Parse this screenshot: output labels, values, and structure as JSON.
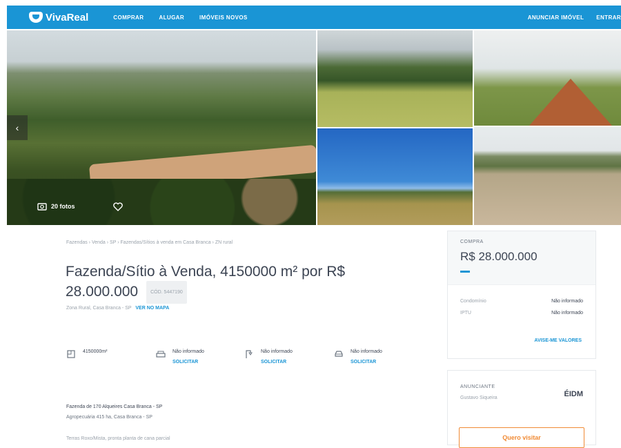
{
  "header": {
    "brand": "VivaReal",
    "nav": [
      "COMPRAR",
      "ALUGAR",
      "IMÓVEIS NOVOS"
    ],
    "right_nav": [
      "ANUNCIAR IMÓVEL",
      "ENTRAR"
    ],
    "color": "#1a95d5"
  },
  "gallery": {
    "photos_label": "20 fotos",
    "prev_arrow": "‹"
  },
  "listing": {
    "breadcrumb": "Fazendas › Venda › SP › Fazendas/Sítios à venda em Casa Branca › ZN rural",
    "title": "Fazenda/Sítio à Venda, 4150000 m² por R$ 28.000.000",
    "code": "CÓD. 5447190",
    "address": "Zona Rural, Casa Branca - SP",
    "map_link": "VER NO MAPA",
    "features": [
      {
        "icon": "area-icon",
        "label": "4150000m²",
        "req": ""
      },
      {
        "icon": "bed-icon",
        "label": "Não informado",
        "req": "SOLICITAR"
      },
      {
        "icon": "shower-icon",
        "label": "Não informado",
        "req": "SOLICITAR"
      },
      {
        "icon": "car-icon",
        "label": "Não informado",
        "req": "SOLICITAR"
      }
    ],
    "desc_line1": "Fazenda de 170 Alqueires Casa Branca - SP",
    "desc_line2": "Agropecuária 415 ha, Casa Branca - SP",
    "desc_line3": "Terras Roxo/Mista, pronta planta de cana parcial"
  },
  "price_card": {
    "label": "COMPRA",
    "price": "R$ 28.000.000",
    "rows": [
      {
        "k": "Condomínio",
        "v": "Não informado"
      },
      {
        "k": "IPTU",
        "v": "Não informado"
      }
    ],
    "see_values": "AVISE-ME VALORES"
  },
  "advertiser": {
    "label": "ANUNCIANTE",
    "name": "Gustavo Siqueira",
    "logo_text": "ÉIDM",
    "cta": "Quero visitar",
    "cta_color": "#f08a34"
  }
}
